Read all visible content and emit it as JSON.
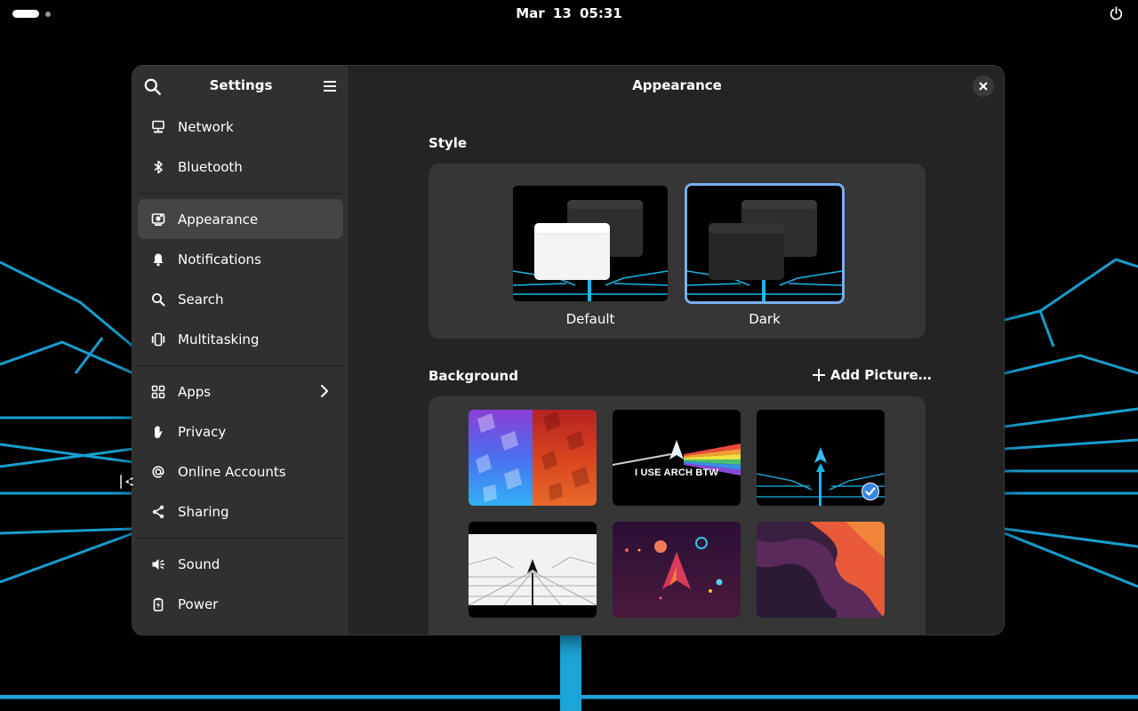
{
  "topbar": {
    "clock": "Mar 13  05:31",
    "power_icon": "power-icon"
  },
  "window": {
    "sidebar": {
      "title": "Settings",
      "groups": [
        [
          {
            "label": "Network",
            "icon": "network-icon"
          },
          {
            "label": "Bluetooth",
            "icon": "bluetooth-icon"
          }
        ],
        [
          {
            "label": "Appearance",
            "icon": "appearance-icon",
            "active": true
          },
          {
            "label": "Notifications",
            "icon": "bell-icon"
          },
          {
            "label": "Search",
            "icon": "search-icon"
          },
          {
            "label": "Multitasking",
            "icon": "multitasking-icon"
          }
        ],
        [
          {
            "label": "Apps",
            "icon": "apps-icon",
            "has_chevron": true
          },
          {
            "label": "Privacy",
            "icon": "hand-icon"
          },
          {
            "label": "Online Accounts",
            "icon": "at-icon"
          },
          {
            "label": "Sharing",
            "icon": "share-icon"
          }
        ],
        [
          {
            "label": "Sound",
            "icon": "speaker-icon"
          },
          {
            "label": "Power",
            "icon": "battery-icon"
          }
        ]
      ]
    },
    "main": {
      "title": "Appearance",
      "style": {
        "heading": "Style",
        "options": [
          {
            "label": "Default",
            "selected": false
          },
          {
            "label": "Dark",
            "selected": true
          }
        ]
      },
      "background": {
        "heading": "Background",
        "add_label": "Add Picture…",
        "thumbnails": [
          {
            "name": "blue-red-hexagons",
            "selected": false
          },
          {
            "name": "arch-prism",
            "text": "I USE ARCH BTW",
            "selected": false
          },
          {
            "name": "arch-neon-grid",
            "selected": true
          },
          {
            "name": "arch-white-grid",
            "selected": false
          },
          {
            "name": "arch-space",
            "selected": false
          },
          {
            "name": "purple-orange-waves",
            "selected": false
          }
        ]
      }
    }
  },
  "colors": {
    "accent": "#78aeed",
    "neon": "#19b6e6",
    "sidebar": "#303030",
    "content": "#242424",
    "card": "#363636"
  }
}
